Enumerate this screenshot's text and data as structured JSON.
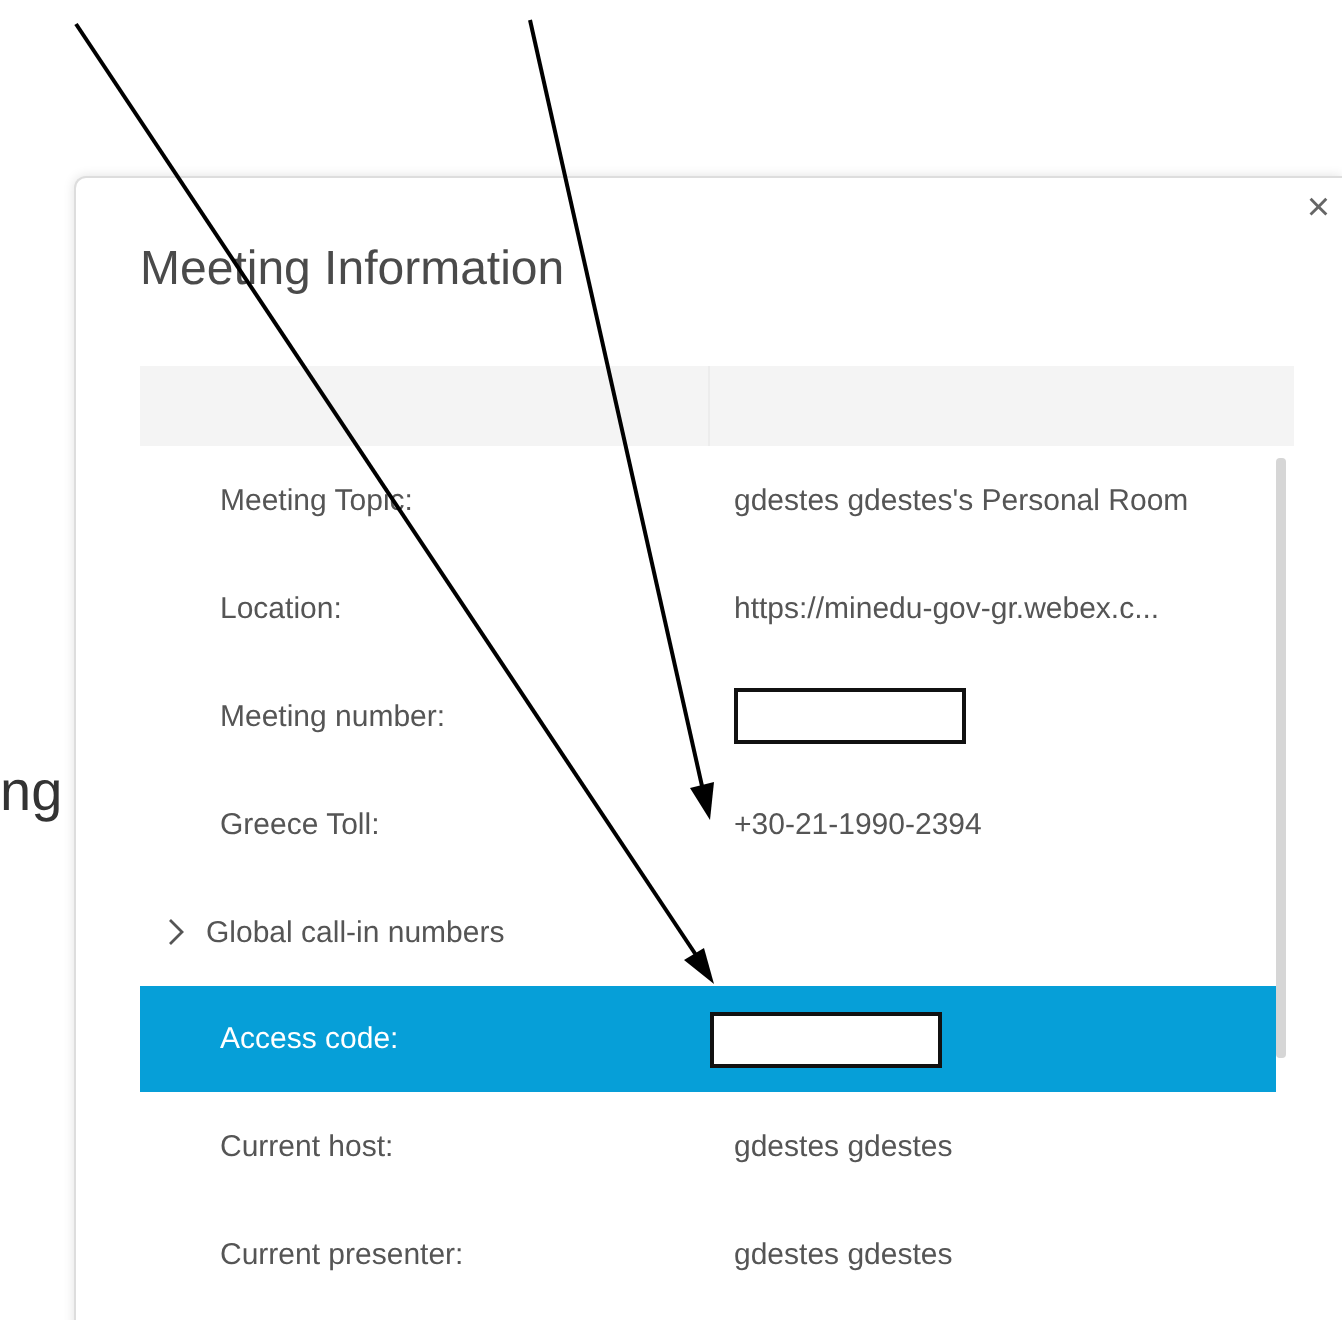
{
  "background_text": [
    {
      "text": "ng"
    }
  ],
  "dialog": {
    "title": "Meeting Information",
    "close": "×",
    "rows": [
      {
        "kind": "field",
        "label": "Meeting Topic:",
        "value": "gdestes gdestes's Personal Room",
        "selected": false
      },
      {
        "kind": "field",
        "label": "Location:",
        "value": "https://minedu-gov-gr.webex.c...",
        "selected": false
      },
      {
        "kind": "redacted",
        "label": "Meeting number:",
        "selected": false
      },
      {
        "kind": "field",
        "label": "Greece Toll:",
        "value": "+30-21-1990-2394",
        "selected": false
      },
      {
        "kind": "expander",
        "label": "Global call-in numbers",
        "expanded": false,
        "selected": false
      },
      {
        "kind": "redacted",
        "label": "Access code:",
        "selected": true
      },
      {
        "kind": "field",
        "label": "Current host:",
        "value": "gdestes gdestes",
        "selected": false
      },
      {
        "kind": "field",
        "label": "Current presenter:",
        "value": "gdestes gdestes",
        "selected": false
      }
    ]
  }
}
